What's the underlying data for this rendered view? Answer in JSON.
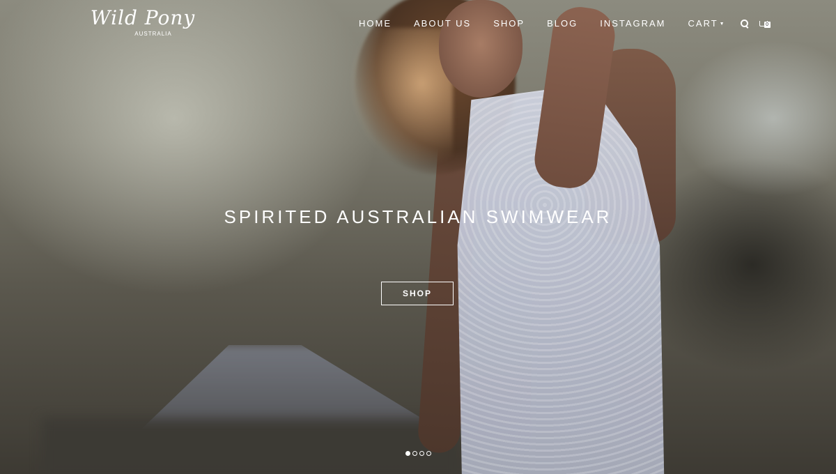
{
  "brand": {
    "name": "Wild Pony",
    "sub": "AUSTRALIA"
  },
  "nav": {
    "items": [
      "HOME",
      "ABOUT US",
      "SHOP",
      "BLOG",
      "INSTAGRAM"
    ],
    "cart_label": "CART",
    "cart_count": "0"
  },
  "hero": {
    "headline": "SPIRITED AUSTRALIAN SWIMWEAR",
    "button": "SHOP"
  },
  "slider": {
    "slide_count": 4,
    "active_index": 0
  },
  "icons": [
    "search-icon",
    "cart-icon",
    "chevron-down-icon"
  ],
  "colors": {
    "text": "#ffffff"
  }
}
